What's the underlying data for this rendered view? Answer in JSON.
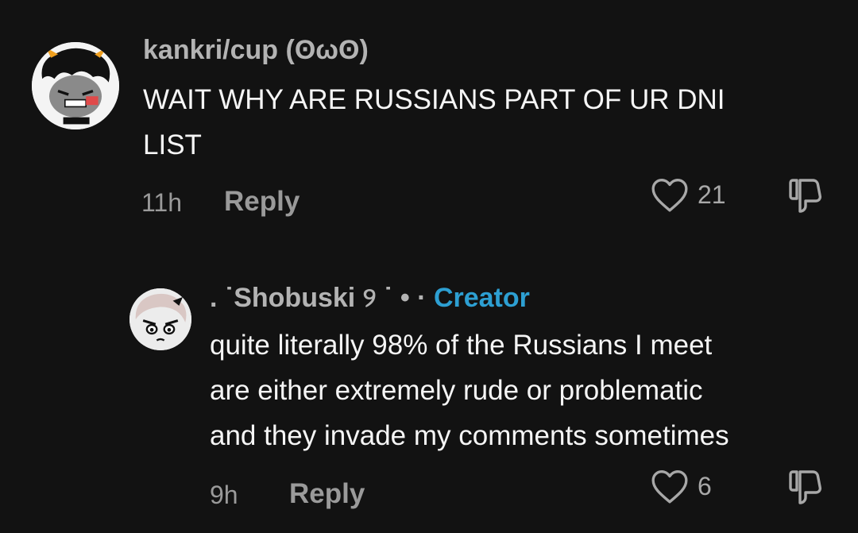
{
  "comments": [
    {
      "username": "kankri/cup (ʘωʘ)",
      "text_lines": [
        "WAIT WHY ARE RUSSIANS PART OF UR DNI",
        "LIST"
      ],
      "time": "11h",
      "reply_label": "Reply",
      "likes": "21"
    }
  ],
  "replies": [
    {
      "username": ". ˙Shobuski ୨ ˙ • ·",
      "badge": "Creator",
      "text_lines": [
        "quite literally 98% of the Russians I meet",
        "are either extremely rude or problematic",
        "and they invade my comments sometimes"
      ],
      "time": "9h",
      "reply_label": "Reply",
      "likes": "6"
    }
  ],
  "colors": {
    "background": "#121212",
    "creator_badge": "#2d9fd2"
  },
  "icons": [
    "heart-icon",
    "dislike-icon"
  ]
}
